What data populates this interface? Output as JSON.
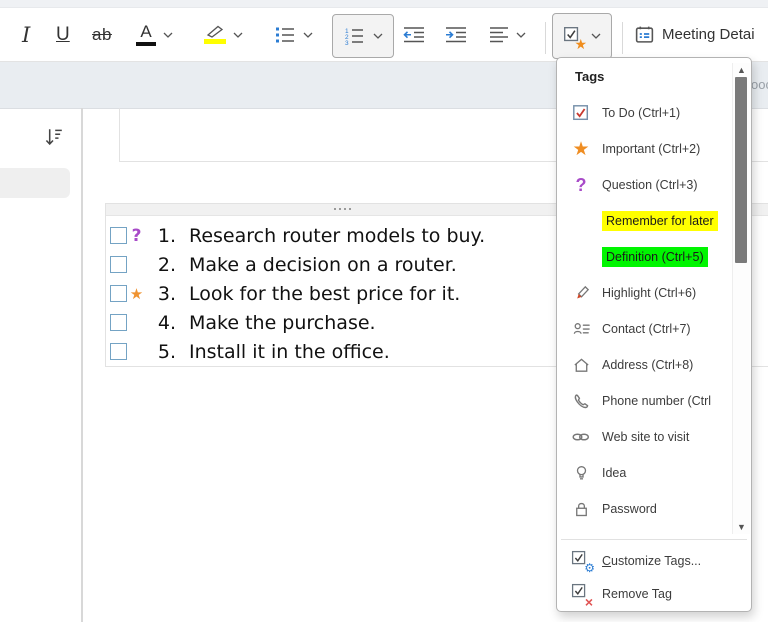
{
  "toolbar": {
    "italic_label": "I",
    "underline_label": "U",
    "strikethrough_label": "ab",
    "font_color_letter": "A",
    "meeting_details_label": "Meeting Detai"
  },
  "ribbon": {
    "partial_text": "ooc"
  },
  "page": {
    "list": [
      {
        "number": "1.",
        "tag_glyph": "?",
        "text": "Research router models to buy."
      },
      {
        "number": "2.",
        "tag_glyph": "",
        "text": "Make a decision on a router."
      },
      {
        "number": "3.",
        "tag_glyph": "★",
        "text": "Look for the best price for it."
      },
      {
        "number": "4.",
        "tag_glyph": "",
        "text": "Make the purchase."
      },
      {
        "number": "5.",
        "tag_glyph": "",
        "text": "Install it in the office."
      }
    ]
  },
  "tags_menu": {
    "title": "Tags",
    "items": [
      {
        "label": "To Do (Ctrl+1)",
        "icon": "todo-checkbox-icon"
      },
      {
        "label": "Important (Ctrl+2)",
        "icon": "star-icon"
      },
      {
        "label": "Question (Ctrl+3)",
        "icon": "question-mark-icon"
      },
      {
        "label": "Remember for later",
        "icon": "",
        "highlight": "#ffff00"
      },
      {
        "label": "Definition (Ctrl+5)",
        "icon": "",
        "highlight": "#00f500"
      },
      {
        "label": "Highlight (Ctrl+6)",
        "icon": "highlighter-pen-icon"
      },
      {
        "label": "Contact (Ctrl+7)",
        "icon": "contact-icon"
      },
      {
        "label": "Address (Ctrl+8)",
        "icon": "house-icon"
      },
      {
        "label": "Phone number (Ctrl",
        "icon": "phone-icon"
      },
      {
        "label": "Web site to visit",
        "icon": "link-icon"
      },
      {
        "label": "Idea",
        "icon": "lightbulb-icon"
      },
      {
        "label": "Password",
        "icon": "padlock-icon"
      }
    ],
    "footer": [
      {
        "pre": "",
        "accel": "C",
        "post": "ustomize Tags..."
      },
      {
        "pre": "Remove Ta",
        "accel": "g",
        "post": ""
      }
    ]
  },
  "colors": {
    "accent_blue": "#2b7cd3",
    "star_orange": "#ef8d22",
    "question_purple": "#a84bc8",
    "todo_check_red": "#c8392f",
    "highlight_yellow": "#ffff00",
    "highlight_green": "#00f500",
    "list_checkbox_blue": "#74a3c4"
  }
}
